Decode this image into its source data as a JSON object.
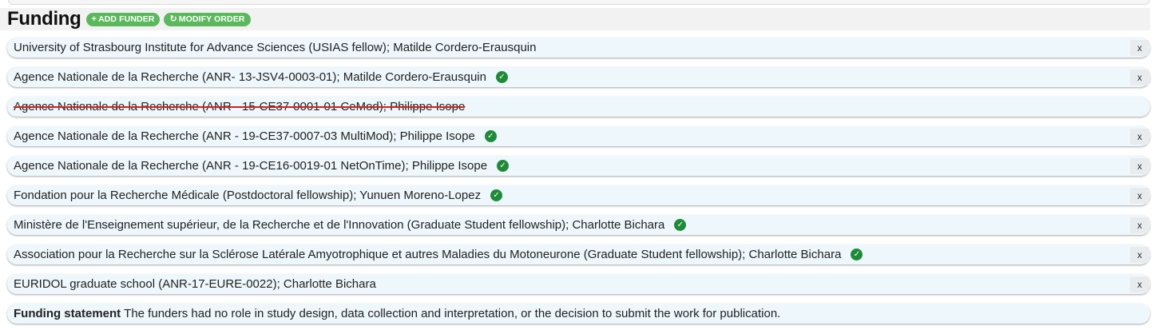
{
  "section": {
    "title": "Funding",
    "add_funder_label": "ADD FUNDER",
    "modify_order_label": "MODIFY ORDER",
    "add_icon": "plus-icon",
    "modify_icon": "refresh-icon"
  },
  "funders": [
    {
      "text": "University of Strasbourg Institute for Advance Sciences (USIAS fellow); Matilde Cordero-Erausquin",
      "verified": false,
      "deleted": false,
      "remove_label": "x"
    },
    {
      "text": "Agence Nationale de la Recherche (ANR- 13-JSV4-0003-01); Matilde Cordero-Erausquin",
      "verified": true,
      "deleted": false,
      "remove_label": "x"
    },
    {
      "text": "Agence Nationale de la Recherche (ANR - 15-CE37-0001-01 CeMod); Philippe Isope",
      "verified": false,
      "deleted": true,
      "remove_label": ""
    },
    {
      "text": "Agence Nationale de la Recherche (ANR - 19-CE37-0007-03 MultiMod); Philippe Isope",
      "verified": true,
      "deleted": false,
      "remove_label": "x"
    },
    {
      "text": "Agence Nationale de la Recherche (ANR - 19-CE16-0019-01 NetOnTime); Philippe Isope",
      "verified": true,
      "deleted": false,
      "remove_label": "x"
    },
    {
      "text": "Fondation pour la Recherche Médicale (Postdoctoral fellowship); Yunuen Moreno-Lopez",
      "verified": true,
      "deleted": false,
      "remove_label": "x"
    },
    {
      "text": "Ministère de l'Enseignement supérieur, de la Recherche et de l'Innovation (Graduate Student fellowship); Charlotte Bichara",
      "verified": true,
      "deleted": false,
      "remove_label": "x"
    },
    {
      "text": "Association pour la Recherche sur la Sclérose Latérale Amyotrophique et autres Maladies du Motoneurone (Graduate Student fellowship); Charlotte Bichara",
      "verified": true,
      "deleted": false,
      "remove_label": "x"
    },
    {
      "text": "EURIDOL graduate school (ANR-17-EURE-0022); Charlotte Bichara",
      "verified": false,
      "deleted": false,
      "remove_label": "x"
    }
  ],
  "statement": {
    "label": "Funding statement",
    "text": "The funders had no role in study design, data collection and interpretation, or the decision to submit the work for publication."
  },
  "colors": {
    "accent_green": "#5bb85c",
    "verified_green": "#1f8a3a",
    "row_background": "#eef7fb",
    "strike_red": "#d02020"
  }
}
